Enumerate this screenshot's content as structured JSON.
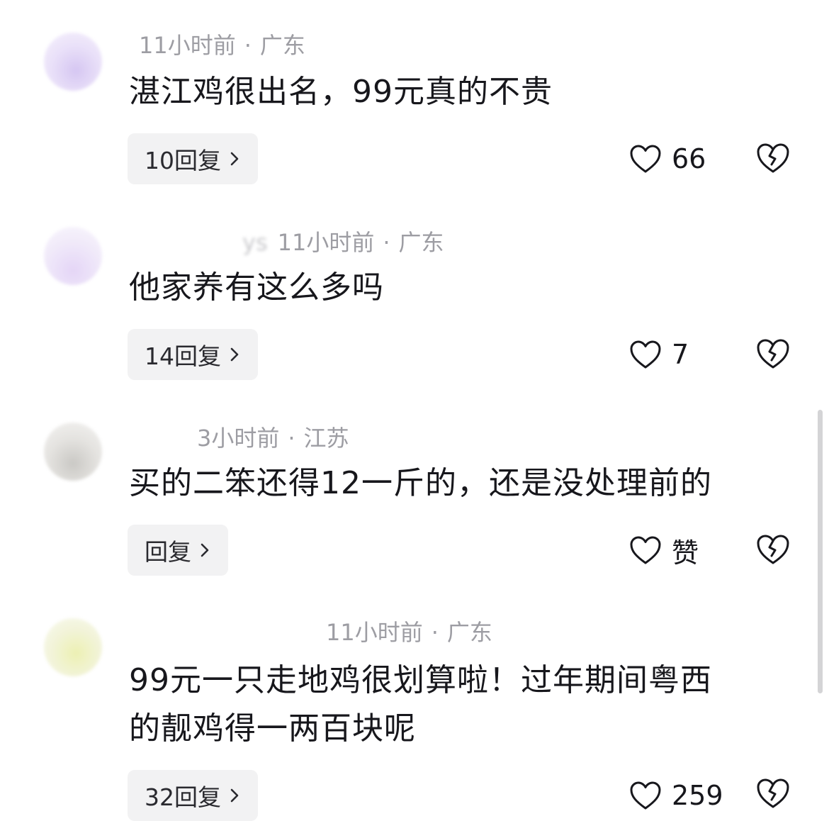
{
  "comments": [
    {
      "time": "11小时前",
      "dot": "·",
      "location": "广东",
      "text": "湛江鸡很出名，99元真的不贵",
      "reply_label": "10回复",
      "likes": "66",
      "avatar_color": "#d9c7f0"
    },
    {
      "username_fragment": "ys",
      "time": "11小时前",
      "dot": "·",
      "location": "广东",
      "text": "他家养有这么多吗",
      "reply_label": "14回复",
      "likes": "7",
      "avatar_color": "#e6d8f2"
    },
    {
      "time": "3小时前",
      "dot": "·",
      "location": "江苏",
      "text": "买的二笨还得12一斤的，还是没处理前的",
      "reply_label": "回复",
      "likes": "赞",
      "avatar_color": "#d8d6d2"
    },
    {
      "time": "11小时前",
      "dot": "·",
      "location": "广东",
      "text_line1": "99元一只走地鸡很划算啦！过年期间粤西",
      "text_line2": "的靓鸡得一两百块呢",
      "reply_label": "32回复",
      "likes": "259",
      "avatar_color": "#e4e9c4"
    }
  ],
  "icons": {
    "like": "heart-outline-icon",
    "dislike": "broken-heart-icon",
    "chevron": "chevron-right-icon"
  }
}
